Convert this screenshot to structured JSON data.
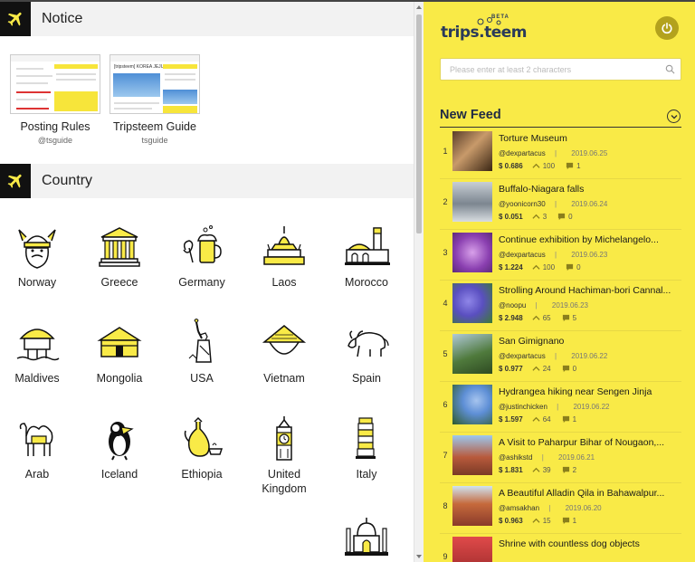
{
  "notice": {
    "title": "Notice",
    "cards": [
      {
        "title": "Posting Rules",
        "author": "@tsguide"
      },
      {
        "title": "Tripsteem Guide",
        "author": "tsguide",
        "thumb_caption": "[tripsteem] KOREA JEJU-SI"
      }
    ]
  },
  "country": {
    "title": "Country",
    "items": [
      {
        "name": "Norway",
        "icon": "viking-helmet-icon"
      },
      {
        "name": "Greece",
        "icon": "greek-temple-icon"
      },
      {
        "name": "Germany",
        "icon": "beer-pretzel-icon"
      },
      {
        "name": "Laos",
        "icon": "lao-stupa-icon"
      },
      {
        "name": "Morocco",
        "icon": "mosque-icon"
      },
      {
        "name": "Maldives",
        "icon": "water-bungalow-icon"
      },
      {
        "name": "Mongolia",
        "icon": "yurt-icon"
      },
      {
        "name": "USA",
        "icon": "statue-of-liberty-icon"
      },
      {
        "name": "Vietnam",
        "icon": "conical-hat-icon"
      },
      {
        "name": "Spain",
        "icon": "bull-icon"
      },
      {
        "name": "Arab",
        "icon": "camel-icon"
      },
      {
        "name": "Iceland",
        "icon": "puffin-icon"
      },
      {
        "name": "Ethiopia",
        "icon": "coffee-pot-icon"
      },
      {
        "name": "United Kingdom",
        "icon": "big-ben-icon"
      },
      {
        "name": "Italy",
        "icon": "leaning-tower-icon"
      },
      {
        "name": "",
        "icon": "taj-mahal-icon"
      }
    ]
  },
  "sidebar": {
    "logo_text": "trips.teem",
    "logo_badge": "BETA",
    "search_placeholder": "Please enter at least 2 characters",
    "feed_title": "New Feed",
    "accent": "#f9ea47"
  },
  "feed": [
    {
      "num": "1",
      "title": "Torture Museum",
      "author": "@dexpartacus",
      "date": "2019.06.25",
      "payout": "$ 0.686",
      "votes": "100",
      "comments": "1"
    },
    {
      "num": "2",
      "title": "Buffalo-Niagara falls",
      "author": "@yoonicorn30",
      "date": "2019.06.24",
      "payout": "$ 0.051",
      "votes": "3",
      "comments": "0"
    },
    {
      "num": "3",
      "title": "Continue exhibition by Michelangelo...",
      "author": "@dexpartacus",
      "date": "2019.06.23",
      "payout": "$ 1.224",
      "votes": "100",
      "comments": "0"
    },
    {
      "num": "4",
      "title": "Strolling Around Hachiman-bori Cannal...",
      "author": "@noopu",
      "date": "2019.06.23",
      "payout": "$ 2.948",
      "votes": "65",
      "comments": "5"
    },
    {
      "num": "5",
      "title": "San Gimignano",
      "author": "@dexpartacus",
      "date": "2019.06.22",
      "payout": "$ 0.977",
      "votes": "24",
      "comments": "0"
    },
    {
      "num": "6",
      "title": "Hydrangea hiking near Sengen Jinja",
      "author": "@justinchicken",
      "date": "2019.06.22",
      "payout": "$ 1.597",
      "votes": "64",
      "comments": "1"
    },
    {
      "num": "7",
      "title": "A Visit to Paharpur Bihar of Nougaon,...",
      "author": "@ashikstd",
      "date": "2019.06.21",
      "payout": "$ 1.831",
      "votes": "39",
      "comments": "2"
    },
    {
      "num": "8",
      "title": "A Beautiful Alladin Qila in Bahawalpur...",
      "author": "@amsakhan",
      "date": "2019.06.20",
      "payout": "$ 0.963",
      "votes": "15",
      "comments": "1"
    },
    {
      "num": "9",
      "title": "Shrine with countless dog objects",
      "author": "",
      "date": "",
      "payout": "",
      "votes": "",
      "comments": ""
    }
  ]
}
